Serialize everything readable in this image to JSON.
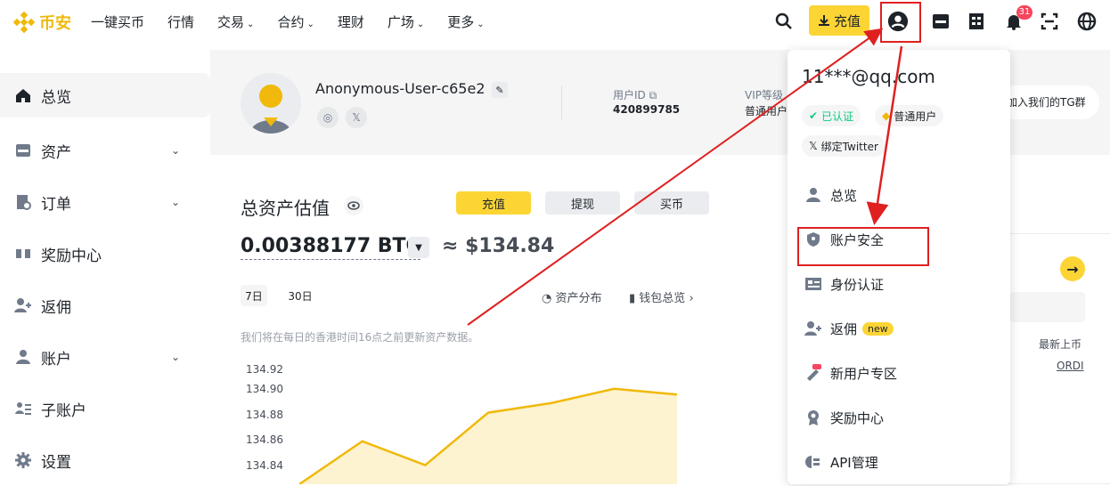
{
  "brand": {
    "name": "币安",
    "color": "#f0b90b"
  },
  "nav": [
    {
      "label": "一键买币",
      "dropdown": false
    },
    {
      "label": "行情",
      "dropdown": false
    },
    {
      "label": "交易",
      "dropdown": true
    },
    {
      "label": "合约",
      "dropdown": true
    },
    {
      "label": "理财",
      "dropdown": false
    },
    {
      "label": "广场",
      "dropdown": true
    },
    {
      "label": "更多",
      "dropdown": true
    }
  ],
  "header": {
    "deposit_label": "充值",
    "notification_count": "31"
  },
  "sidebar": {
    "items": [
      {
        "label": "总览",
        "icon": "home-icon",
        "active": true
      },
      {
        "label": "资产",
        "icon": "wallet-icon",
        "expandable": true
      },
      {
        "label": "订单",
        "icon": "orders-icon",
        "expandable": true
      },
      {
        "label": "奖励中心",
        "icon": "reward-icon"
      },
      {
        "label": "返佣",
        "icon": "referral-icon"
      },
      {
        "label": "账户",
        "icon": "user-icon",
        "expandable": true
      },
      {
        "label": "子账户",
        "icon": "subaccount-icon"
      },
      {
        "label": "设置",
        "icon": "gear-icon"
      }
    ]
  },
  "profile": {
    "username": "Anonymous-User-c65e2",
    "uid_label": "用户ID",
    "uid_value": "420899785",
    "vip_label": "VIP等级",
    "vip_value": "普通用户",
    "tg_text": "加入我们的TG群"
  },
  "assets": {
    "title": "总资产估值",
    "buttons": {
      "deposit": "充值",
      "withdraw": "提现",
      "buy": "买币"
    },
    "btc_value": "0.00388177 BTC",
    "usd_value": "≈ $134.84",
    "periods": [
      "7日",
      "30日"
    ],
    "links": {
      "distribution": "资产分布",
      "wallet": "钱包总览"
    },
    "notice": "我们将在每日的香港时间16点之前更新资产数据。"
  },
  "chart_data": {
    "type": "area",
    "color": "#f0b90b",
    "y_ticks": [
      "134.92",
      "134.90",
      "134.88",
      "134.86",
      "134.84"
    ],
    "ylim": [
      134.8,
      134.925
    ],
    "values": [
      134.8,
      134.845,
      134.82,
      134.875,
      134.885,
      134.9,
      134.894
    ],
    "grid": false
  },
  "right_panel": {
    "latest_label": "最新上币",
    "latest_coin": "ORDI"
  },
  "dropdown": {
    "email": "11***@qq.com",
    "tags": {
      "verified": "已认证",
      "user_level": "普通用户",
      "twitter": "绑定Twitter"
    },
    "items": [
      {
        "label": "总览",
        "icon": "user-icon"
      },
      {
        "label": "账户安全",
        "icon": "shield-icon"
      },
      {
        "label": "身份认证",
        "icon": "id-card-icon"
      },
      {
        "label": "返佣",
        "icon": "referral-icon",
        "badge": "new"
      },
      {
        "label": "新用户专区",
        "icon": "gift-icon"
      },
      {
        "label": "奖励中心",
        "icon": "medal-icon"
      },
      {
        "label": "API管理",
        "icon": "api-icon"
      }
    ]
  }
}
